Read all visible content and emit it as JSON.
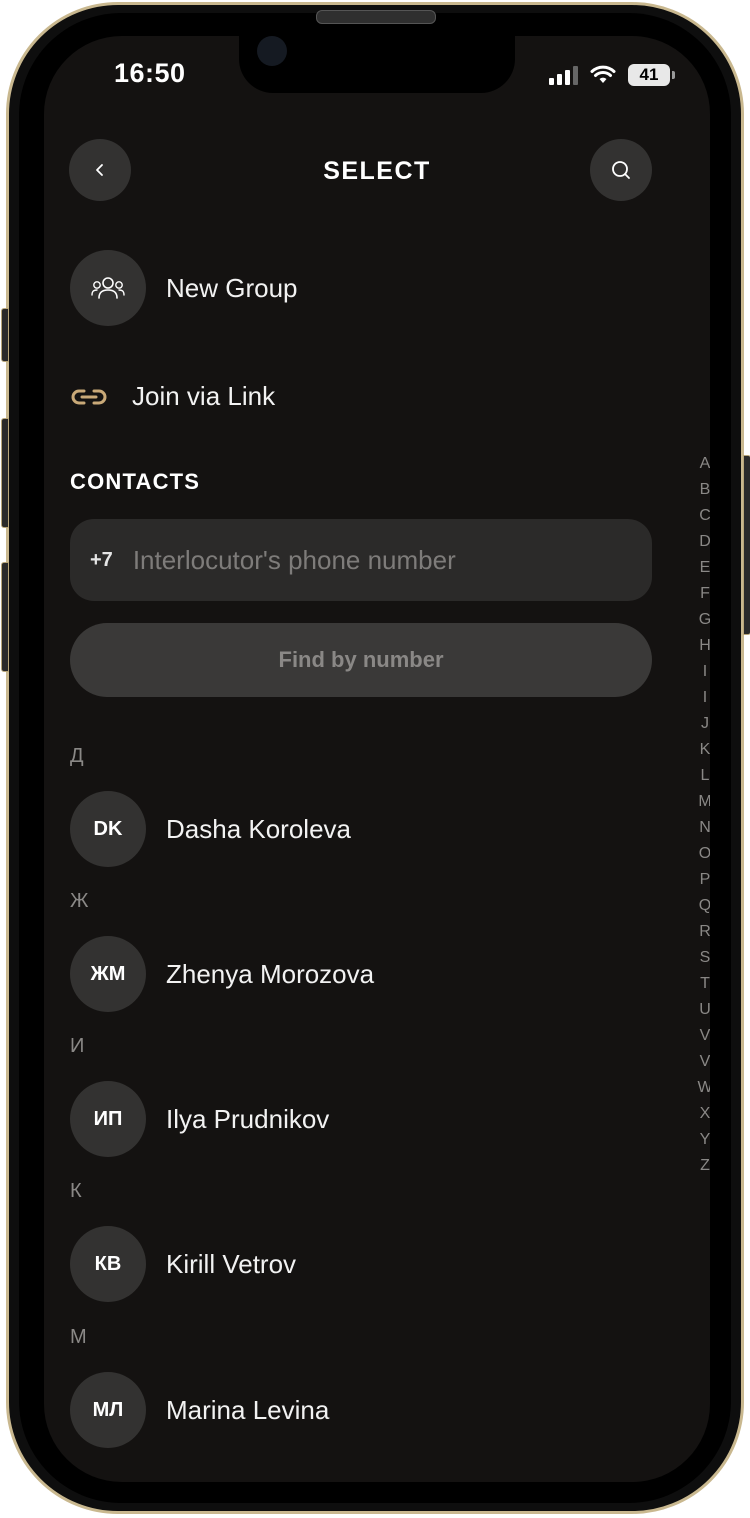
{
  "status": {
    "time": "16:50",
    "battery": "41"
  },
  "header": {
    "title": "SELECT",
    "back_icon": "chevron-left-icon",
    "search_icon": "search-icon"
  },
  "actions": {
    "new_group": {
      "label": "New Group",
      "icon": "group-icon"
    },
    "join_link": {
      "label": "Join via Link",
      "icon": "link-icon"
    }
  },
  "contacts": {
    "title": "CONTACTS",
    "phone_prefix": "+7",
    "phone_placeholder": "Interlocutor's phone number",
    "find_label": "Find by number",
    "groups": [
      {
        "letter": "Д",
        "initials": "DK",
        "name": "Dasha Koroleva"
      },
      {
        "letter": "Ж",
        "initials": "ЖМ",
        "name": "Zhenya Morozova"
      },
      {
        "letter": "И",
        "initials": "ИП",
        "name": "Ilya Prudnikov"
      },
      {
        "letter": "К",
        "initials": "КВ",
        "name": "Kirill Vetrov"
      },
      {
        "letter": "М",
        "initials": "МЛ",
        "name": "Marina Levina"
      }
    ]
  },
  "alphabet": [
    "A",
    "B",
    "C",
    "D",
    "E",
    "F",
    "G",
    "H",
    "I",
    "I",
    "J",
    "K",
    "L",
    "M",
    "N",
    "O",
    "P",
    "Q",
    "R",
    "S",
    "T",
    "U",
    "V",
    "V",
    "W",
    "X",
    "Y",
    "Z"
  ],
  "colors": {
    "background": "#141211",
    "surface": "#333231",
    "accent": "#c9a978",
    "muted": "#8a8886"
  }
}
